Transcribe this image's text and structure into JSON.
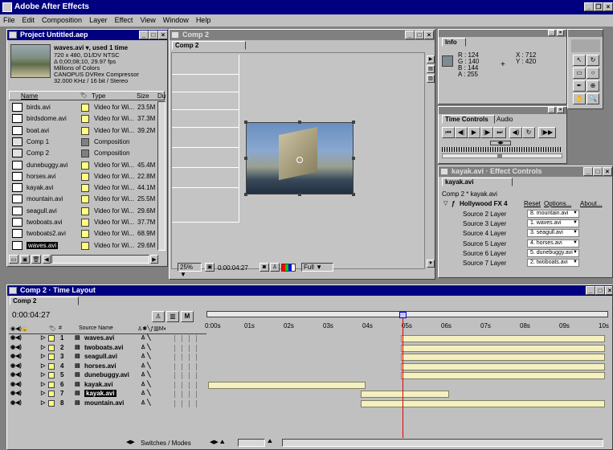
{
  "app": {
    "title": "Adobe After Effects"
  },
  "menu": [
    "File",
    "Edit",
    "Composition",
    "Layer",
    "Effect",
    "View",
    "Window",
    "Help"
  ],
  "project": {
    "title": "Project Untitled.aep",
    "preview_name": "waves.avi ▾, used 1 time",
    "preview_info": [
      "720 x 480, D1/DV NTSC",
      "Δ 0;00;08;10, 29.97 fps",
      "Millions of Colors",
      "CANOPUS DVRex Compressor",
      "32.000 KHz / 16 bit / Stereo"
    ],
    "columns": {
      "name": "Name",
      "type": "Type",
      "size": "Size",
      "du": "Du"
    },
    "items": [
      {
        "name": "birds.avi",
        "type": "Video for Wi...",
        "size": "23.5M",
        "kind": "video",
        "color": "#ffff80"
      },
      {
        "name": "birdsdome.avi",
        "type": "Video for Wi...",
        "size": "37.3M",
        "kind": "video",
        "color": "#ffff80"
      },
      {
        "name": "boat.avi",
        "type": "Video for Wi...",
        "size": "39.2M",
        "kind": "video",
        "color": "#ffff80"
      },
      {
        "name": "Comp 1",
        "type": "Composition",
        "size": "",
        "kind": "comp",
        "color": "#808080"
      },
      {
        "name": "Comp 2",
        "type": "Composition",
        "size": "",
        "kind": "comp",
        "color": "#808080"
      },
      {
        "name": "dunebuggy.avi",
        "type": "Video for Wi...",
        "size": "45.4M",
        "kind": "video",
        "color": "#ffff80"
      },
      {
        "name": "horses.avi",
        "type": "Video for Wi...",
        "size": "22.8M",
        "kind": "video",
        "color": "#ffff80"
      },
      {
        "name": "kayak.avi",
        "type": "Video for Wi...",
        "size": "44.1M",
        "kind": "video",
        "color": "#ffff80"
      },
      {
        "name": "mountain.avi",
        "type": "Video for Wi...",
        "size": "25.5M",
        "kind": "video",
        "color": "#ffff80"
      },
      {
        "name": "seagull.avi",
        "type": "Video for Wi...",
        "size": "29.6M",
        "kind": "video",
        "color": "#ffff80"
      },
      {
        "name": "twoboats.avi",
        "type": "Video for Wi...",
        "size": "37.7M",
        "kind": "video",
        "color": "#ffff80"
      },
      {
        "name": "twoboats2.avi",
        "type": "Video for Wi...",
        "size": "68.9M",
        "kind": "video",
        "color": "#ffff80"
      },
      {
        "name": "waves.avi",
        "type": "Video for Wi...",
        "size": "29.6M",
        "kind": "video",
        "color": "#ffff80",
        "selected": true
      }
    ]
  },
  "comp": {
    "title": "Comp 2",
    "tab": "Comp 2",
    "zoom": "25%",
    "timecode": "0:00:04:27",
    "res": "Full"
  },
  "info": {
    "tab": "Info",
    "r": "R : 124",
    "g": "G : 140",
    "b": "B : 144",
    "a": "A : 255",
    "x": "X : 712",
    "y": "Y : 420"
  },
  "time_controls": {
    "tab1": "Time Controls",
    "tab2": "Audio"
  },
  "effects": {
    "title": "kayak.avi · Effect Controls",
    "tab": "kayak.avi",
    "path": "Comp 2 * kayak.avi",
    "effect_name": "Hollywood FX 4",
    "reset": "Reset",
    "options": "Options...",
    "about": "About...",
    "params": [
      {
        "label": "Source 2 Layer",
        "value": "8. mountain.avi"
      },
      {
        "label": "Source 3 Layer",
        "value": "1. waves.avi"
      },
      {
        "label": "Source 4 Layer",
        "value": "3. seagull.avi"
      },
      {
        "label": "Source 5 Layer",
        "value": "4. horses.avi"
      },
      {
        "label": "Source 6 Layer",
        "value": "5. dunebuggy.avi"
      },
      {
        "label": "Source 7 Layer",
        "value": "2. twoboats.avi"
      }
    ]
  },
  "timeline": {
    "title": "Comp 2 · Time Layout",
    "tab": "Comp 2",
    "timecode": "0:00:04:27",
    "source_col": "Source Name",
    "num_col": "#",
    "ticks": [
      "0:00s",
      "01s",
      "02s",
      "03s",
      "04s",
      "05s",
      "06s",
      "07s",
      "08s",
      "09s",
      "10s"
    ],
    "footer": "Switches / Modes",
    "layers": [
      {
        "num": "1",
        "name": "waves.avi",
        "start": 0.0,
        "end": 1.0
      },
      {
        "num": "2",
        "name": "twoboats.avi",
        "start": 0.0,
        "end": 1.0
      },
      {
        "num": "3",
        "name": "seagull.avi",
        "start": 0.0,
        "end": 1.0
      },
      {
        "num": "4",
        "name": "horses.avi",
        "start": 0.0,
        "end": 1.0
      },
      {
        "num": "5",
        "name": "dunebuggy.avi",
        "start": 0.0,
        "end": 1.0
      },
      {
        "num": "6",
        "name": "kayak.avi",
        "start": 0.0,
        "end": 1.0
      },
      {
        "num": "7",
        "name": "kayak.avi",
        "start": 0.0,
        "end": 1.0,
        "selected": true
      },
      {
        "num": "8",
        "name": "mountain.avi",
        "start": 0.0,
        "end": 1.0
      }
    ]
  }
}
